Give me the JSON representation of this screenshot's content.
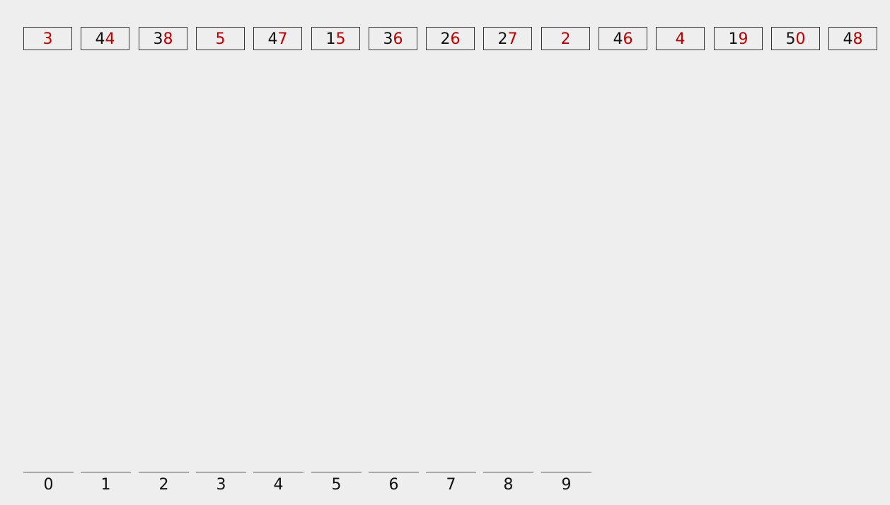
{
  "theme": {
    "background": "#eeeeee",
    "text": "#111111",
    "highlight": "#c00000"
  },
  "numbers": [
    {
      "prefix": "",
      "digit": "3"
    },
    {
      "prefix": "4",
      "digit": "4"
    },
    {
      "prefix": "3",
      "digit": "8"
    },
    {
      "prefix": "",
      "digit": "5"
    },
    {
      "prefix": "4",
      "digit": "7"
    },
    {
      "prefix": "1",
      "digit": "5"
    },
    {
      "prefix": "3",
      "digit": "6"
    },
    {
      "prefix": "2",
      "digit": "6"
    },
    {
      "prefix": "2",
      "digit": "7"
    },
    {
      "prefix": "",
      "digit": "2"
    },
    {
      "prefix": "4",
      "digit": "6"
    },
    {
      "prefix": "",
      "digit": "4"
    },
    {
      "prefix": "1",
      "digit": "9"
    },
    {
      "prefix": "5",
      "digit": "0"
    },
    {
      "prefix": "4",
      "digit": "8"
    }
  ],
  "buckets": [
    "0",
    "1",
    "2",
    "3",
    "4",
    "5",
    "6",
    "7",
    "8",
    "9"
  ]
}
